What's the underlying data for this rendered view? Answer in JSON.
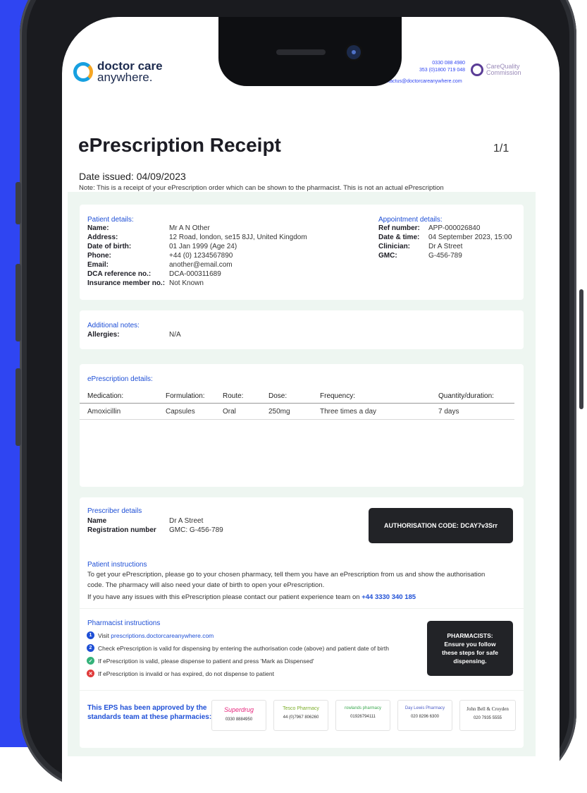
{
  "header": {
    "logo_line1": "doctor care",
    "logo_line2": "anywhere.",
    "phone_1": "0330 088 4980",
    "phone_2": "353 (0)1800 719 048",
    "email": "contactus@doctorcareanywhere.com",
    "cqc_line1": "CareQuality",
    "cqc_line2": "Commission"
  },
  "document": {
    "title": "ePrescription Receipt",
    "page": "1/1",
    "date_issued": "Date issued: 04/09/2023",
    "note": "Note: This is a receipt of your ePrescription order which can be shown to the pharmacist. This is not an actual ePrescription"
  },
  "patient": {
    "heading": "Patient details:",
    "fields": [
      {
        "label": "Name:",
        "value": "Mr A N Other"
      },
      {
        "label": "Address:",
        "value": "12 Road, london, se15 8JJ, United Kingdom"
      },
      {
        "label": "Date of birth:",
        "value": "01 Jan 1999 (Age 24)"
      },
      {
        "label": "Phone:",
        "value": "+44 (0) 1234567890"
      },
      {
        "label": "Email:",
        "value": "another@email.com"
      },
      {
        "label": "DCA reference no.:",
        "value": "DCA-000311689"
      },
      {
        "label": "Insurance member no.:",
        "value": "Not Known"
      }
    ]
  },
  "appointment": {
    "heading": "Appointment details:",
    "fields": [
      {
        "label": "Ref number:",
        "value": "APP-000026840"
      },
      {
        "label": "Date & time:",
        "value": "04 September 2023, 15:00"
      },
      {
        "label": "Clinician:",
        "value": "Dr A Street"
      },
      {
        "label": "GMC:",
        "value": "G-456-789"
      }
    ]
  },
  "additional": {
    "heading": "Additional notes:",
    "allergies_label": "Allergies:",
    "allergies_value": "N/A"
  },
  "eprescription": {
    "heading": "ePrescription details:",
    "columns": [
      "Medication:",
      "Formulation:",
      "Route:",
      "Dose:",
      "Frequency:",
      "Quantity/duration:"
    ],
    "rows": [
      [
        "Amoxicillin",
        "Capsules",
        "Oral",
        "250mg",
        "Three times a day",
        "7 days"
      ]
    ]
  },
  "prescriber": {
    "heading": "Prescriber details",
    "name_label": "Name",
    "name_value": "Dr A Street",
    "reg_label": "Registration number",
    "reg_value": "GMC: G-456-789",
    "auth_code": "AUTHORISATION CODE: DCAY7v3Srr"
  },
  "patient_instructions": {
    "heading": "Patient instructions",
    "line1": "To get your ePrescription, please go to your chosen pharmacy, tell them you have an ePrescription from us and show the authorisation",
    "line2": "code. The pharmacy will also need your date of birth to open your ePrescription.",
    "line3_prefix": "If you have any issues with this ePrescription please contact our patient experience team on",
    "phone": "+44 3330 340 185"
  },
  "pharmacist_instructions": {
    "heading": "Pharmacist instructions",
    "step1_prefix": "Visit",
    "step1_link": "prescriptions.doctorcareanywhere.com",
    "step2": "Check ePrescription is valid for dispensing by entering the authorisation code (above) and patient date of birth",
    "step3": "If ePrescription is valid, please dispense to patient and press 'Mark as Dispensed'",
    "step4": "If ePrescription is invalid or has expired, do not dispense to patient",
    "box_line1": "PHARMACISTS:",
    "box_line2": "Ensure you follow",
    "box_line3": "these steps for safe",
    "box_line4": "dispensing."
  },
  "approval": {
    "text_line1": "This EPS has been approved by the",
    "text_line2": "standards team at these pharmacies:",
    "pharmacies": [
      {
        "name": "Superdrug",
        "phone": "0330 8884950"
      },
      {
        "name": "Tesco Pharmacy",
        "phone": "44 (0)7967 806260"
      },
      {
        "name": "rowlands pharmacy",
        "phone": "01926794111"
      },
      {
        "name": "Day Lewis Pharmacy",
        "phone": "020 8296 6300"
      },
      {
        "name": "John Bell & Croyden",
        "phone": "020 7935 5555"
      }
    ]
  },
  "colors": {
    "background_blue": "#2f45f2",
    "link_blue": "#1e4fd6",
    "panel_dark": "#222327"
  }
}
